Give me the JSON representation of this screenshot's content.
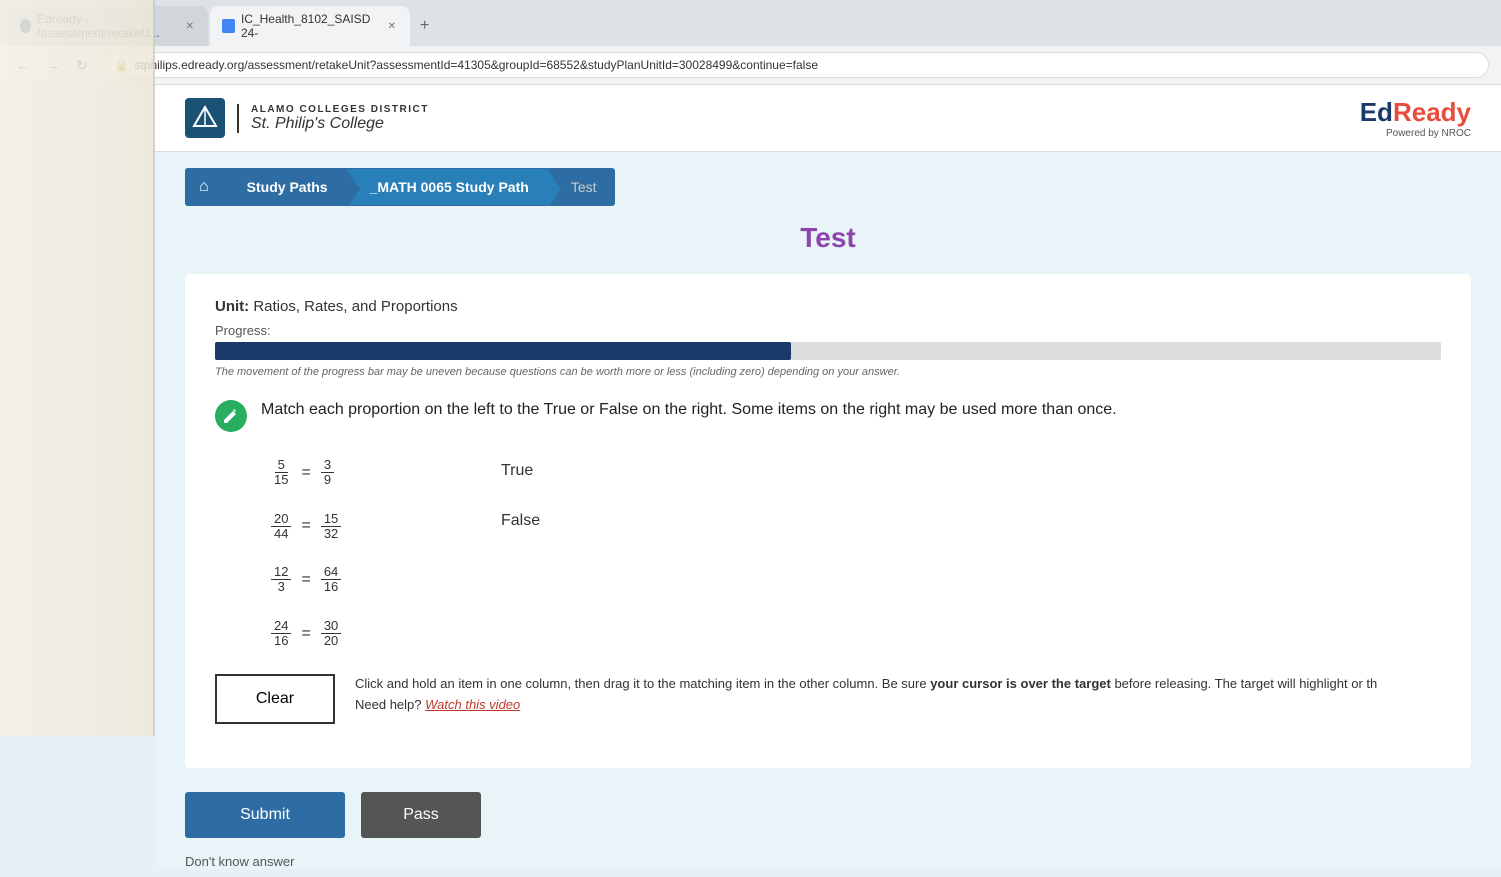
{
  "browser": {
    "url": "stphilips.edready.org/assessment/retakeUnit?assessmentId=41305&groupId=68552&studyPlanUnitId=30028499&continue=false",
    "tabs": [
      {
        "id": "edready-tab",
        "title": "Edready - /assessment/retakeU...",
        "active": false,
        "icon": "edready"
      },
      {
        "id": "health-tab",
        "title": "IC_Health_8102_SAISD 24-",
        "active": true,
        "icon": "blue"
      }
    ],
    "nav": {
      "back": "←",
      "forward": "→",
      "refresh": "↻"
    }
  },
  "header": {
    "college_district": "ALAMO COLLEGES DISTRICT",
    "college_name": "St. Philip's College",
    "edready_brand": "EdReady",
    "powered_by": "Powered by NROC"
  },
  "breadcrumb": {
    "home_icon": "⌂",
    "items": [
      {
        "label": "Study Paths",
        "active": false
      },
      {
        "label": "_MATH 0065 Study Path",
        "active": true
      },
      {
        "label": "Test",
        "active": false
      }
    ]
  },
  "page": {
    "title": "Test"
  },
  "unit": {
    "label": "Unit:",
    "name": "Ratios, Rates, and Proportions",
    "progress_label": "Progress:",
    "progress_percent": 47,
    "progress_note": "The movement of the progress bar may be uneven because questions can be worth more or less (including zero) depending on your answer."
  },
  "question": {
    "instruction": "Match each proportion on the left to the True or False on the right. Some items on the right may be used more than once.",
    "proportions": [
      {
        "id": "prop1",
        "num1": "5",
        "den1": "15",
        "num2": "3",
        "den2": "9"
      },
      {
        "id": "prop2",
        "num1": "20",
        "den1": "44",
        "num2": "15",
        "den2": "32"
      },
      {
        "id": "prop3",
        "num1": "12",
        "den1": "3",
        "num2": "64",
        "den2": "16"
      },
      {
        "id": "prop4",
        "num1": "24",
        "den1": "16",
        "num2": "30",
        "den2": "20"
      }
    ],
    "answers": [
      {
        "id": "true",
        "label": "True"
      },
      {
        "id": "false",
        "label": "False"
      }
    ]
  },
  "instruction_box": {
    "instruction_text": "Click and hold an item in one column, then drag it to the matching item in the other column. Be sure ",
    "bold_part": "your cursor is over the target",
    "instruction_text2": " before releasing. The target will highlight or th",
    "help_text": "Need help?",
    "watch_link": "Watch this video"
  },
  "buttons": {
    "clear": "Clear",
    "submit": "Submit",
    "pass": "Pass",
    "dont_know": "Don't know answer"
  }
}
